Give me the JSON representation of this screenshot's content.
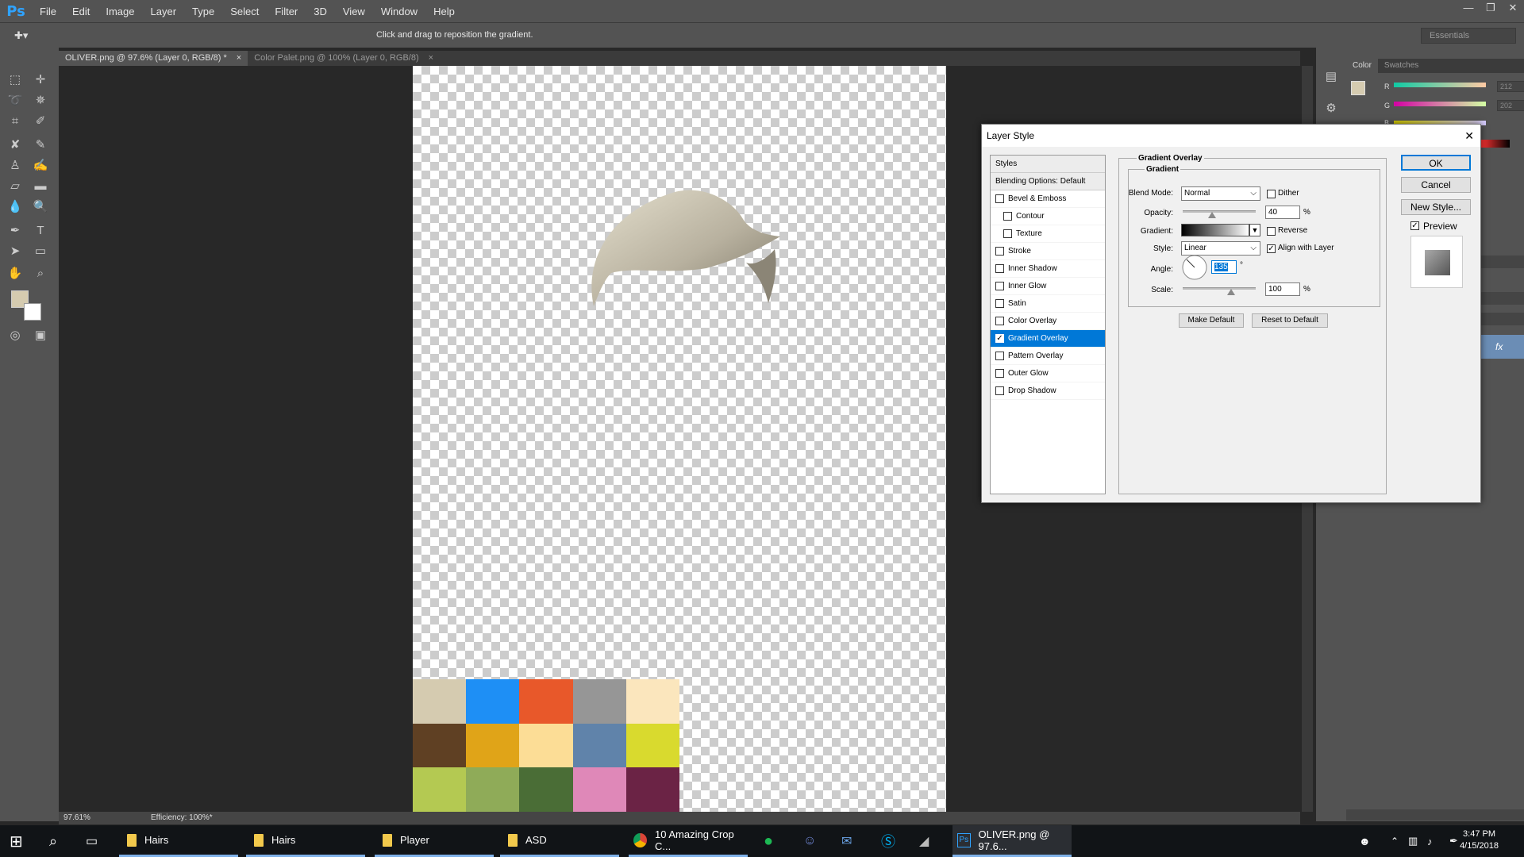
{
  "app": {
    "logo": "Ps"
  },
  "menu": [
    "File",
    "Edit",
    "Image",
    "Layer",
    "Type",
    "Select",
    "Filter",
    "3D",
    "View",
    "Window",
    "Help"
  ],
  "window_controls": {
    "minimize": "—",
    "restore": "❐",
    "close": "✕"
  },
  "options_bar": {
    "hint": "Click and drag to reposition the gradient.",
    "workspace": "Essentials"
  },
  "tabs": [
    {
      "label": "OLIVER.png @ 97.6% (Layer 0, RGB/8) *",
      "close": "×"
    },
    {
      "label": "Color Palet.png @ 100% (Layer 0, RGB/8)",
      "close": "×"
    }
  ],
  "status": {
    "zoom": "97.61%",
    "efficiency": "Efficiency: 100%*"
  },
  "palette_colors": [
    "#d5cbb0",
    "#1e8ff5",
    "#e8582a",
    "#969696",
    "#fbe6bd",
    "#5f4023",
    "#e0a418",
    "#fcdd96",
    "#6083aa",
    "#d9da2e",
    "#b4c952",
    "#8fab58",
    "#4a6d36",
    "#df88b8",
    "#6b2345"
  ],
  "color_panel": {
    "tabs": [
      "Color",
      "Swatches"
    ],
    "labels": {
      "r": "R",
      "g": "G",
      "b": "B"
    },
    "values": {
      "r": "212",
      "g": "202"
    },
    "fg_color": "#d5cbb0",
    "bg_color": "#ffffff"
  },
  "dialog": {
    "title": "Layer Style",
    "styles_header": "Styles",
    "blending": "Blending Options: Default",
    "items": [
      {
        "label": "Bevel & Emboss",
        "checked": false
      },
      {
        "label": "Contour",
        "checked": false
      },
      {
        "label": "Texture",
        "checked": false
      },
      {
        "label": "Stroke",
        "checked": false
      },
      {
        "label": "Inner Shadow",
        "checked": false
      },
      {
        "label": "Inner Glow",
        "checked": false
      },
      {
        "label": "Satin",
        "checked": false
      },
      {
        "label": "Color Overlay",
        "checked": false
      },
      {
        "label": "Gradient Overlay",
        "checked": true
      },
      {
        "label": "Pattern Overlay",
        "checked": false
      },
      {
        "label": "Outer Glow",
        "checked": false
      },
      {
        "label": "Drop Shadow",
        "checked": false
      }
    ],
    "group_title": "Gradient Overlay",
    "subgroup_title": "Gradient",
    "blend_mode_label": "Blend Mode:",
    "blend_mode": "Normal",
    "dither": "Dither",
    "opacity_label": "Opacity:",
    "opacity": "40",
    "opacity_fraction": 0.4,
    "pct": "%",
    "gradient_label": "Gradient:",
    "reverse": "Reverse",
    "style_label": "Style:",
    "style": "Linear",
    "align": "Align with Layer",
    "angle_label": "Angle:",
    "angle": "135",
    "degree": "°",
    "scale_label": "Scale:",
    "scale": "100",
    "scale_fraction": 0.6667,
    "make_default": "Make Default",
    "reset_default": "Reset to Default",
    "ok": "OK",
    "cancel": "Cancel",
    "new_style": "New Style...",
    "preview": "Preview"
  },
  "taskbar": {
    "items": [
      {
        "label": "Hairs",
        "icon": "folder-icon"
      },
      {
        "label": "Hairs",
        "icon": "folder-icon"
      },
      {
        "label": "Player",
        "icon": "folder-icon"
      },
      {
        "label": "ASD",
        "icon": "folder-icon"
      },
      {
        "label": "10 Amazing Crop C...",
        "icon": "chrome-icon"
      },
      {
        "label": "OLIVER.png @ 97.6...",
        "icon": "photoshop-icon"
      }
    ],
    "time": "3:47 PM",
    "date": "4/15/2018"
  }
}
